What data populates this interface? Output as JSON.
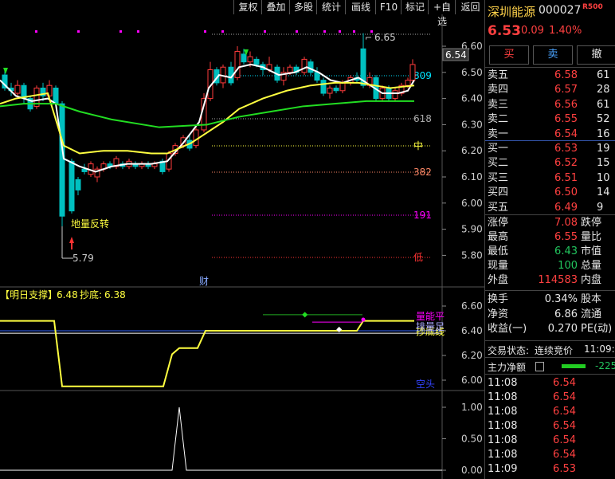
{
  "toolbar": {
    "items": [
      "复权",
      "叠加",
      "多股",
      "统计",
      "画线",
      "F10",
      "标记",
      "+自选",
      "返回"
    ]
  },
  "stock": {
    "name": "深圳能源",
    "code": "000027",
    "badge": "R500",
    "price": "6.53",
    "change": "0.09",
    "pct": "1.40%"
  },
  "actions": {
    "buy": "买",
    "sell": "卖",
    "cancel": "撤"
  },
  "order_book": {
    "asks": [
      {
        "label": "卖五",
        "price": "6.58",
        "vol": "61"
      },
      {
        "label": "卖四",
        "price": "6.57",
        "vol": "28"
      },
      {
        "label": "卖三",
        "price": "6.56",
        "vol": "61"
      },
      {
        "label": "卖二",
        "price": "6.55",
        "vol": "52"
      },
      {
        "label": "卖一",
        "price": "6.54",
        "vol": "16"
      }
    ],
    "bids": [
      {
        "label": "买一",
        "price": "6.53",
        "vol": "19"
      },
      {
        "label": "买二",
        "price": "6.52",
        "vol": "15"
      },
      {
        "label": "买三",
        "price": "6.51",
        "vol": "10"
      },
      {
        "label": "买四",
        "price": "6.50",
        "vol": "14"
      },
      {
        "label": "买五",
        "price": "6.49",
        "vol": "9"
      }
    ]
  },
  "quote": {
    "limit_up_label": "涨停",
    "limit_up": "7.08",
    "limit_down_label": "跌停",
    "high_label": "最高",
    "high": "6.55",
    "vol_ratio_label": "量比",
    "low_label": "最低",
    "low": "6.43",
    "mktcap_label": "市值",
    "last_vol_label": "现量",
    "last_vol": "100",
    "total_vol_label": "总量",
    "outer_label": "外盘",
    "outer": "114583",
    "inner_label": "内盘",
    "turnover_label": "换手",
    "turnover": "0.34%",
    "equity_label": "股本",
    "nav_label": "净资",
    "nav": "6.86",
    "float_label": "流通",
    "eps_label": "收益(一)",
    "eps": "0.270",
    "pe_label": "PE(动)"
  },
  "status": {
    "label": "交易状态:",
    "value": "连续竞价",
    "time": "11:09:",
    "main_flow_label": "主力净额",
    "main_flow": "-225"
  },
  "ticks": [
    {
      "time": "11:08",
      "price": "6.54"
    },
    {
      "time": "11:08",
      "price": "6.54"
    },
    {
      "time": "11:08",
      "price": "6.54"
    },
    {
      "time": "11:08",
      "price": "6.54"
    },
    {
      "time": "11:08",
      "price": "6.54"
    },
    {
      "time": "11:08",
      "price": "6.54"
    },
    {
      "time": "11:09",
      "price": "6.53"
    }
  ],
  "main_chart": {
    "y_ticks": [
      "6.60",
      "6.50",
      "6.40",
      "6.30",
      "6.20",
      "6.10",
      "6.00",
      "5.90",
      "5.80"
    ],
    "price_marker": "6.54",
    "high_mark": "6.65",
    "low_mark": "5.79",
    "level_labels": [
      "809",
      "618",
      "中",
      "382",
      "191",
      "低"
    ],
    "annotation": "地量反转",
    "event_mark": "财"
  },
  "indicator": {
    "title": "【明日支撑】:",
    "support_value": "6.48",
    "bottom_label": "抄底:",
    "bottom_value": "6.38",
    "y_ticks": [
      "6.60",
      "6.40",
      "6.20",
      "6.00"
    ],
    "legend": [
      "量能平",
      "抄底线",
      "排量足",
      "空头"
    ]
  },
  "volume_panel": {
    "y_ticks": [
      "1.00",
      "0.50",
      "0.00"
    ]
  },
  "colors": {
    "up": "#ff3b3b",
    "down": "#00c0c0",
    "ma_white": "#ffffff",
    "ma_yellow": "#ffff40",
    "ma_green": "#22dd22",
    "magenta": "#ff00ff"
  }
}
